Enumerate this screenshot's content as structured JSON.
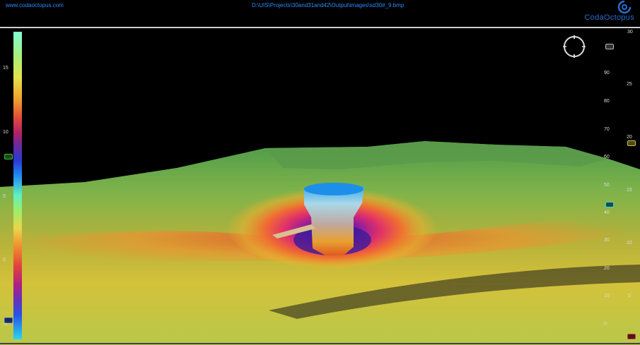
{
  "header": {
    "website": "www.codaoctopus.com",
    "file_path": "D:\\UIS\\Projects\\30and31and42\\Output\\images\\sd30#_9.bmp",
    "brand_name": "CodaOctopus"
  },
  "color_scale": {
    "ticks": [
      "15",
      "10",
      "5",
      "0",
      "-5"
    ]
  },
  "axis_inner": {
    "ticks": [
      "90",
      "80",
      "70",
      "60",
      "50",
      "40",
      "30",
      "20",
      "10",
      "0"
    ]
  },
  "axis_outer": {
    "ticks": [
      "30",
      "25",
      "20",
      "15",
      "10",
      "5"
    ]
  },
  "colors": {
    "accent": "#2a8cff",
    "background": "#000000",
    "separator": "#cfcfcf"
  },
  "icons": [
    "compass-icon",
    "brand-logo-icon"
  ]
}
